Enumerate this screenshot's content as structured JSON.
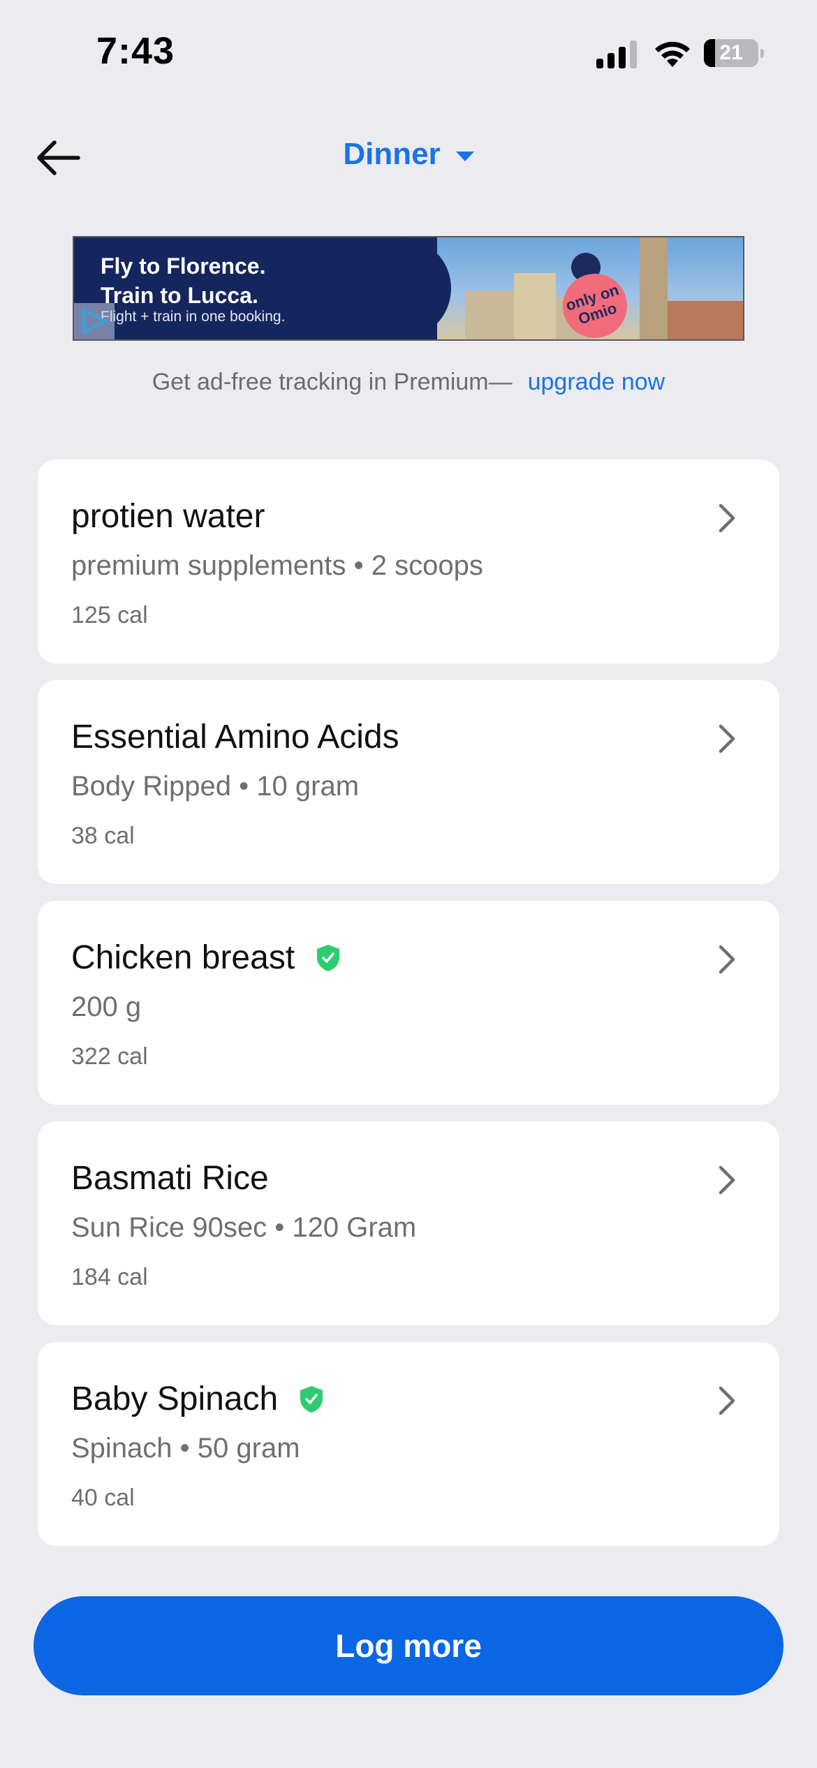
{
  "status_bar": {
    "time": "7:43",
    "battery_level": "21",
    "icons": [
      "signal-icon",
      "wifi-icon",
      "battery-icon"
    ]
  },
  "header": {
    "back_icon": "arrow-left-icon",
    "meal_title": "Dinner",
    "meal_caret_icon": "caret-down-icon",
    "accent_color": "#1a73e8"
  },
  "ad": {
    "headline": "Fly to Florence.\nTrain to Lucca.",
    "subline": "Flight + train in one booking.",
    "badge": "only on Omio"
  },
  "premium": {
    "text": "Get ad-free tracking in Premium—",
    "link": "upgrade now"
  },
  "foods": [
    {
      "name": "protien water",
      "verified": false,
      "detail": "premium supplements • 2 scoops",
      "calories": "125 cal"
    },
    {
      "name": "Essential Amino Acids",
      "verified": false,
      "detail": "Body  Ripped • 10 gram",
      "calories": "38 cal"
    },
    {
      "name": "Chicken breast",
      "verified": true,
      "detail": "200 g",
      "calories": "322 cal"
    },
    {
      "name": "Basmati Rice",
      "verified": false,
      "detail": "Sun Rice 90sec • 120 Gram",
      "calories": "184 cal"
    },
    {
      "name": "Baby Spinach",
      "verified": true,
      "detail": "Spinach • 50 gram",
      "calories": "40 cal"
    }
  ],
  "actions": {
    "log_more": "Log more",
    "button_color": "#0b66e4"
  },
  "colors": {
    "background": "#ebebf0",
    "verified_green": "#2ecc71"
  }
}
